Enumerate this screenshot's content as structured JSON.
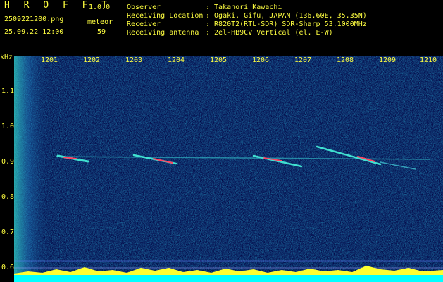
{
  "app": {
    "title": "H R O F F T",
    "version": "1.0.0"
  },
  "file": {
    "name": "2509221200.png",
    "datetime": "25.09.22 12:00"
  },
  "meteor": {
    "label": "meteor",
    "count": "59"
  },
  "info": [
    {
      "key": "Observer",
      "value": ": Takanori Kawachi"
    },
    {
      "key": "Receiving Location",
      "value": ": Ogaki, Gifu, JAPAN (136.60E, 35.35N)"
    },
    {
      "key": "Receiver",
      "value": ": R820T2(RTL-SDR) SDR-Sharp 53.1000MHz"
    },
    {
      "key": "Receiving antenna",
      "value": ": 2el-HB9CV Vertical (el. E-W)"
    }
  ],
  "axis": {
    "unit": "kHz",
    "y_ticks": [
      "1.1",
      "1.0",
      "0.9",
      "0.8",
      "0.7",
      "0.6"
    ],
    "x_ticks": [
      "1201",
      "1202",
      "1203",
      "1204",
      "1205",
      "1206",
      "1207",
      "1208",
      "1209",
      "1210"
    ]
  },
  "colors": {
    "text": "#ffff40",
    "background": "#00003a",
    "noise": "#0a2a8a",
    "signal": "#40e0d0",
    "hot": "#ff4060"
  }
}
